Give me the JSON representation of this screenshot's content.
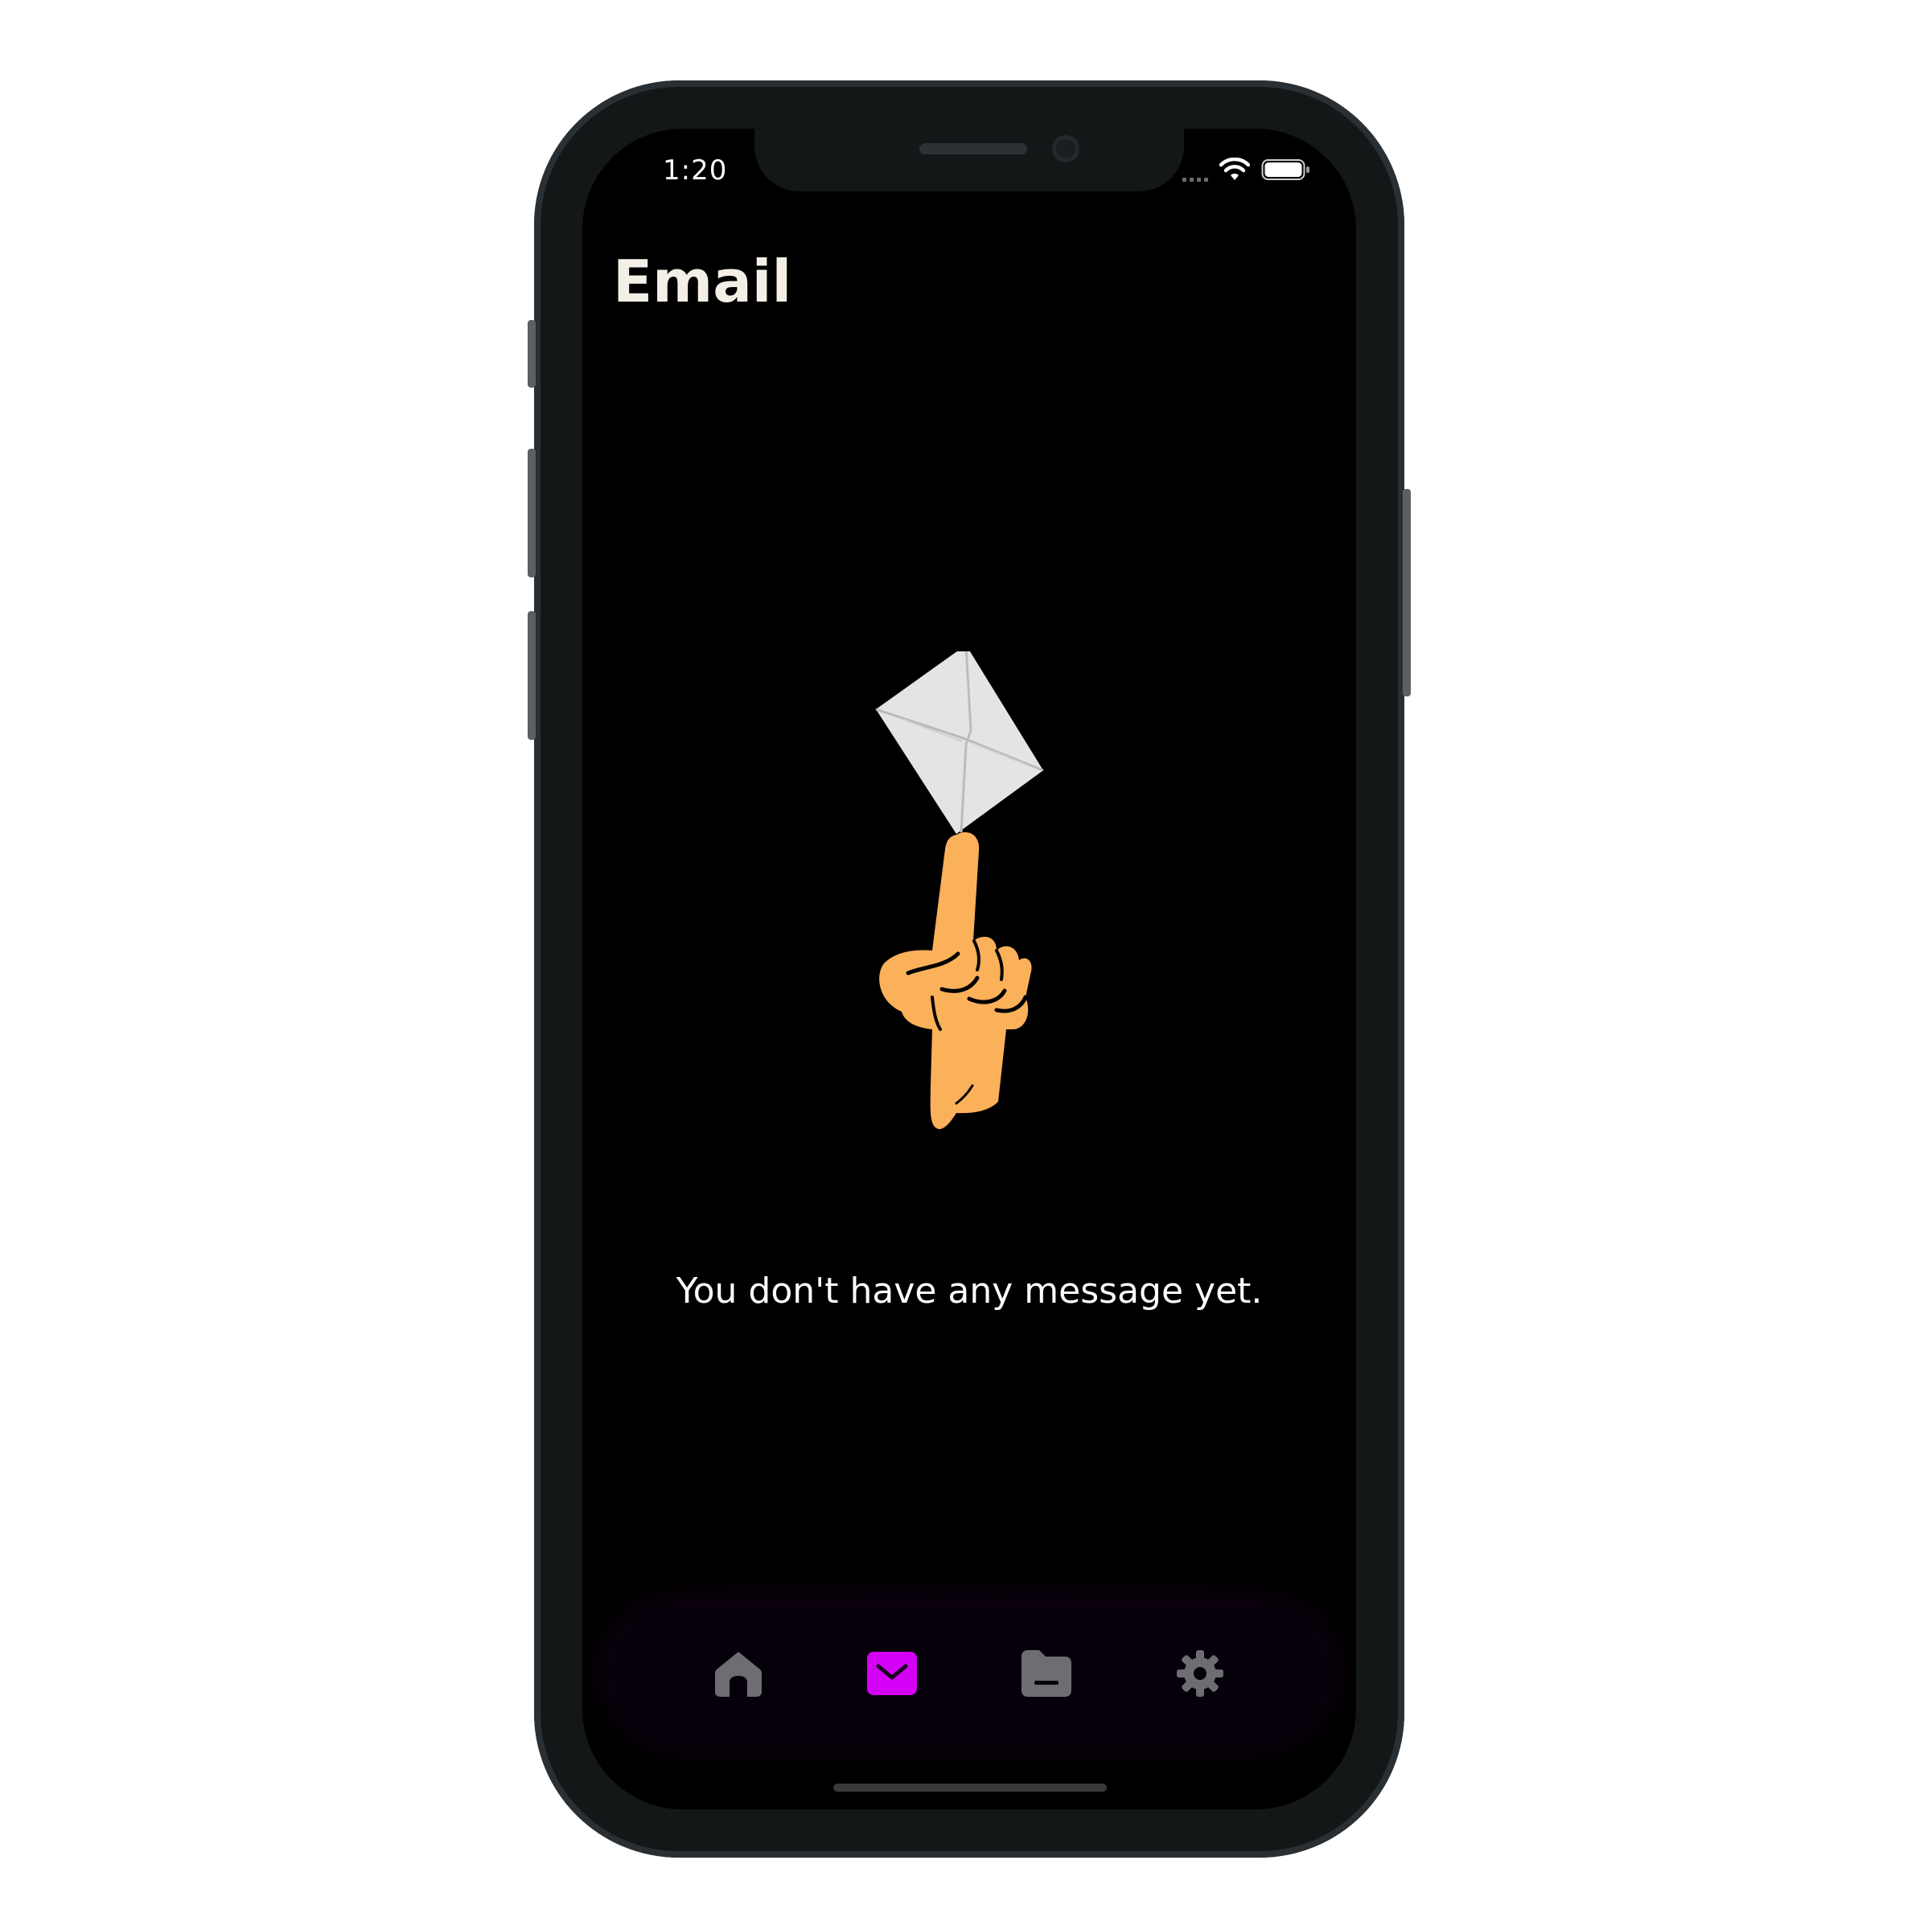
{
  "status_bar": {
    "time": "1:20"
  },
  "header": {
    "title": "Email"
  },
  "empty_state": {
    "illustration": "hand-balancing-envelope",
    "message": "You don't have any message yet."
  },
  "tab_bar": {
    "items": [
      {
        "icon": "home-icon",
        "active": false
      },
      {
        "icon": "mail-icon",
        "active": true
      },
      {
        "icon": "folder-icon",
        "active": false
      },
      {
        "icon": "gear-icon",
        "active": false
      }
    ],
    "active_color": "#d400f5",
    "inactive_color": "#6e6e72"
  },
  "colors": {
    "background": "#000000",
    "title": "#f4efe6",
    "hand": "#fbb05a",
    "envelope": "#e4e4e4"
  }
}
